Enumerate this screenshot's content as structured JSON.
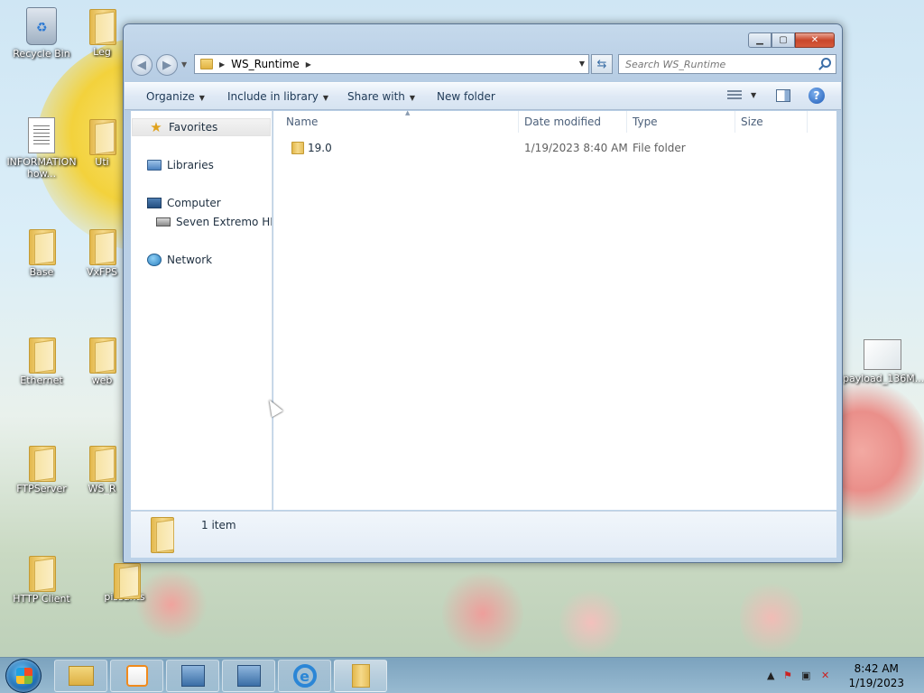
{
  "desktop": {
    "icons": [
      {
        "label": "Recycle Bin",
        "icon": "recycle-bin-icon"
      },
      {
        "label": "Leg",
        "icon": "folder-icon"
      },
      {
        "label": "INFORMATION how...",
        "icon": "text-document-icon"
      },
      {
        "label": "Uti",
        "icon": "folder-icon"
      },
      {
        "label": "Base",
        "icon": "folder-icon"
      },
      {
        "label": "VxFPS",
        "icon": "folder-icon"
      },
      {
        "label": "Ethernet",
        "icon": "folder-icon"
      },
      {
        "label": "web",
        "icon": "folder-icon"
      },
      {
        "label": "FTPServer",
        "icon": "folder-icon"
      },
      {
        "label": "WS_R",
        "icon": "folder-icon"
      },
      {
        "label": "HTTP Client",
        "icon": "folder-icon"
      },
      {
        "label": "pissants",
        "icon": "archive-icon"
      },
      {
        "label": "payload_136M...",
        "icon": "image-file-icon"
      }
    ]
  },
  "window": {
    "address": {
      "path": [
        "WS_Runtime"
      ]
    },
    "search": {
      "placeholder": "Search WS_Runtime"
    },
    "toolbar": {
      "organize": "Organize",
      "include_in_library": "Include in library",
      "share_with": "Share with",
      "new_folder": "New folder"
    },
    "nav_pane": {
      "favorites": "Favorites",
      "libraries": "Libraries",
      "computer": "Computer",
      "drive": "Seven Extremo HD (",
      "network": "Network"
    },
    "columns": {
      "name": "Name",
      "date_modified": "Date modified",
      "type": "Type",
      "size": "Size"
    },
    "files": [
      {
        "name": "19.0",
        "date_modified": "1/19/2023 8:40 AM",
        "type": "File folder",
        "size": ""
      }
    ],
    "details": {
      "count": "1 item"
    }
  },
  "taskbar": {
    "clock": {
      "time": "8:42 AM",
      "date": "1/19/2023"
    },
    "buttons": [
      "explorer-icon",
      "media-player-icon",
      "network-app-icon",
      "network-app-icon",
      "internet-explorer-icon",
      "folder-icon"
    ]
  }
}
